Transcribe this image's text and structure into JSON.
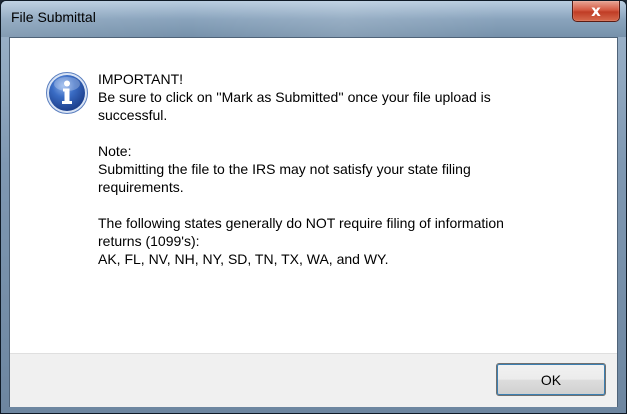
{
  "window": {
    "title": "File Submittal",
    "close_glyph": "x"
  },
  "message": {
    "icon": "info-icon",
    "heading": "IMPORTANT!",
    "important_lines": [
      "Be sure to click on ''Mark as Submitted'' once your file upload is",
      "successful."
    ],
    "note_heading": "Note:",
    "note_lines": [
      "Submitting the file to the IRS may not satisfy your state filing",
      "requirements."
    ],
    "states_lines": [
      "The following states generally do NOT require filing of information",
      "returns (1099's):",
      "AK, FL, NV, NH, NY, SD, TN, TX, WA, and WY."
    ]
  },
  "buttons": {
    "ok_label": "OK"
  },
  "colors": {
    "info_icon_fill": "#2e5fb4",
    "close_button": "#c8432b"
  }
}
